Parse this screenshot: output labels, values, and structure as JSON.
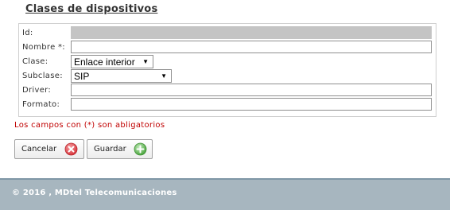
{
  "page": {
    "title": "Clases de dispositivos"
  },
  "form": {
    "fields": [
      {
        "label": "Id:",
        "value": ""
      },
      {
        "label": "Nombre *:",
        "value": ""
      },
      {
        "label": "Clase:",
        "selected": "Enlace interior"
      },
      {
        "label": "Subclase:",
        "selected": "SIP"
      },
      {
        "label": "Driver:",
        "value": ""
      },
      {
        "label": "Formato:",
        "value": ""
      }
    ],
    "required_note": "Los campos con (*) son abligatorios"
  },
  "buttons": {
    "cancel_label": "Cancelar",
    "save_label": "Guardar",
    "cancel_icon": "cancel-x-icon",
    "save_icon": "add-plus-icon"
  },
  "footer": {
    "text": "© 2016 , MDtel Telecomunicaciones"
  },
  "colors": {
    "required_text": "#c00000",
    "footer_bg": "#a7b6bf",
    "cancel_icon": "#e0444a",
    "save_icon": "#5cba4f"
  }
}
